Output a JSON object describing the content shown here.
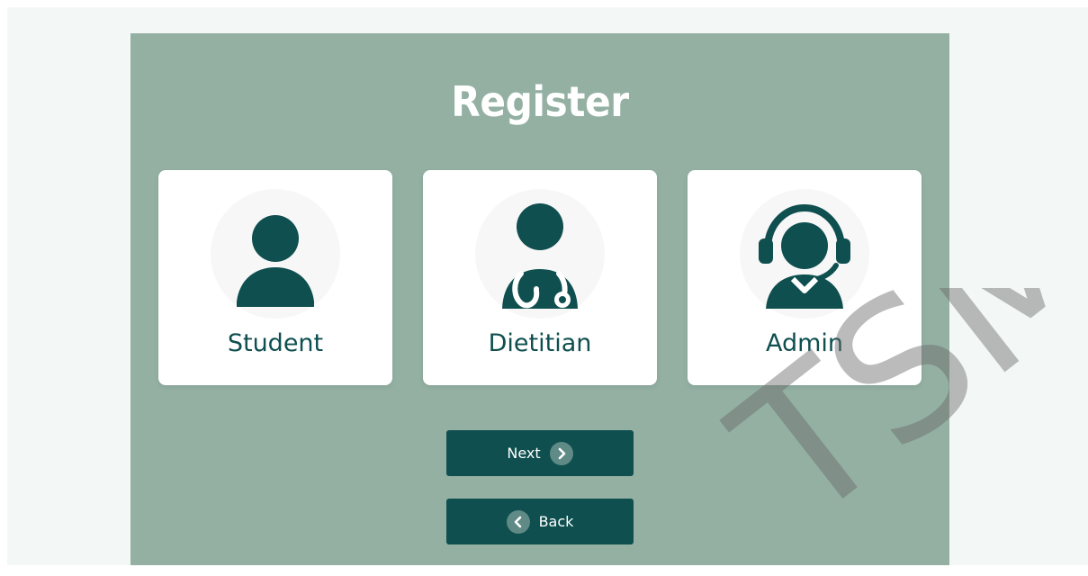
{
  "page": {
    "title": "Register"
  },
  "roles": [
    {
      "label": "Student",
      "icon": "student-user-icon"
    },
    {
      "label": "Dietitian",
      "icon": "dietitian-stethoscope-icon"
    },
    {
      "label": "Admin",
      "icon": "admin-headset-icon"
    }
  ],
  "actions": {
    "next_label": "Next",
    "back_label": "Back",
    "next_icon": "chevron-right-icon",
    "back_icon": "chevron-left-icon"
  },
  "watermark": {
    "text": "TSM"
  },
  "colors": {
    "panel": "#93b0a3",
    "accent": "#0f4f4f",
    "card": "#ffffff",
    "page": "#f3f8f6"
  }
}
